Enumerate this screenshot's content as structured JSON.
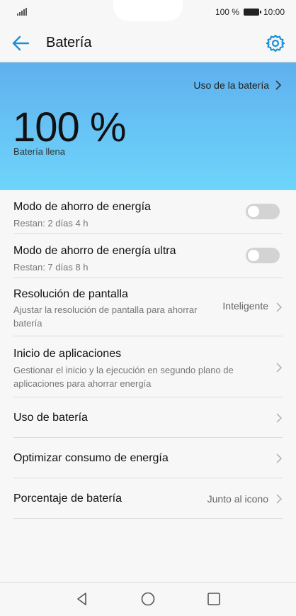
{
  "status_bar": {
    "battery_percent": "100 %",
    "time": "10:00"
  },
  "header": {
    "title": "Batería"
  },
  "hero": {
    "usage_link": "Uso de la batería",
    "percent": "100 %",
    "status": "Batería llena",
    "gradient_from": "#5fb0ee",
    "gradient_to": "#6ed5fb"
  },
  "rows": [
    {
      "main": "Modo de ahorro de energía",
      "sub": "Restan: 2 días 4 h",
      "toggle": "off"
    },
    {
      "main": "Modo de ahorro de energía ultra",
      "sub": "Restan: 7 días 8 h",
      "toggle": "off"
    },
    {
      "main": "Resolución de pantalla",
      "sub": "Ajustar la resolución de pantalla para ahorrar batería",
      "value": "Inteligente"
    },
    {
      "main": "Inicio de aplicaciones",
      "sub": "Gestionar el inicio y la ejecución en segundo plano de aplicaciones para ahorrar energía"
    },
    {
      "main": "Uso de batería"
    },
    {
      "main": "Optimizar consumo de energía"
    },
    {
      "main": "Porcentaje de batería",
      "value": "Junto al icono"
    }
  ],
  "colors": {
    "accent": "#1a8fd8"
  },
  "icons": [
    "back-arrow-icon",
    "gear-icon",
    "chevron-right-icon",
    "nav-back-icon",
    "nav-home-icon",
    "nav-recents-icon"
  ]
}
